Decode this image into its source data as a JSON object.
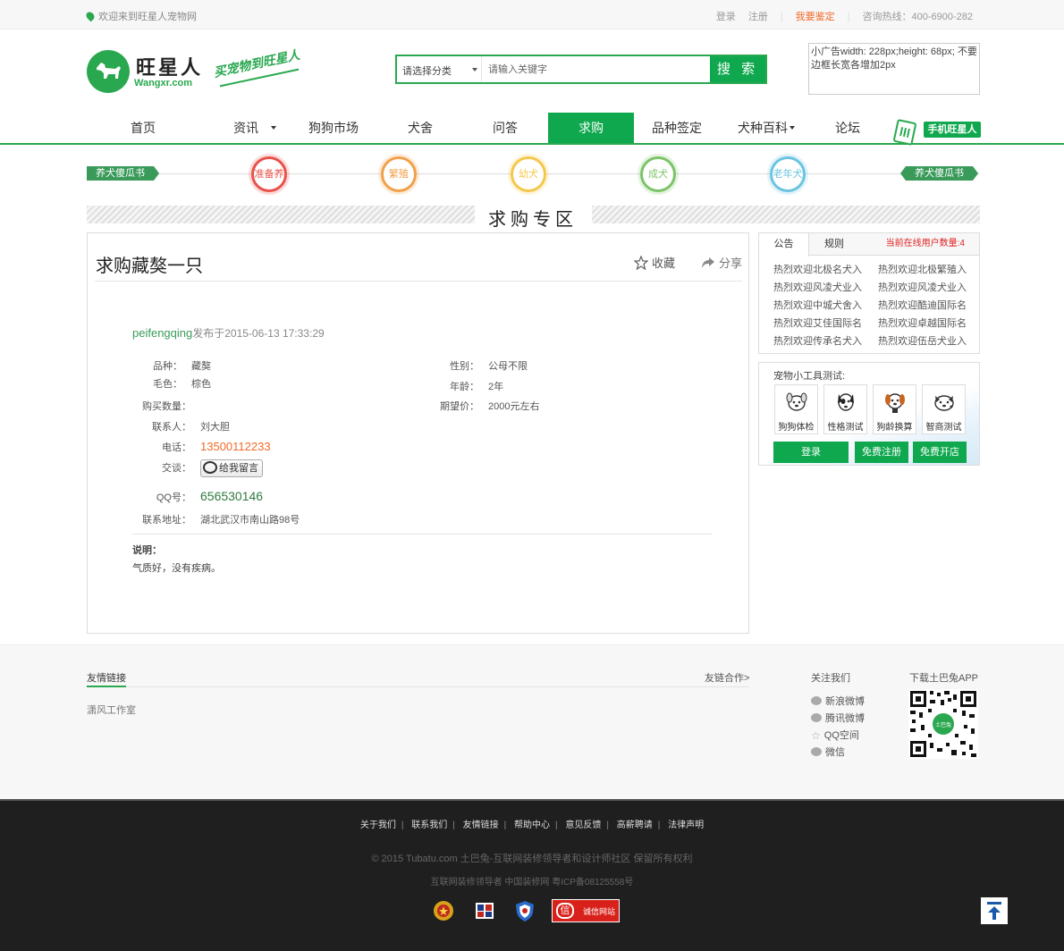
{
  "topbar": {
    "welcome": "欢迎来到旺星人宠物网",
    "login": "登录",
    "register": "注册",
    "appraise": "我要鉴定",
    "hotline": "咨询热线：400-6900-282"
  },
  "header": {
    "logo_text": "旺星人",
    "logo_sub": "Wangxr.com",
    "slogan": "买宠物到旺星人",
    "search": {
      "category": "请选择分类",
      "placeholder": "请输入关键字",
      "button": "搜 索"
    },
    "ad_text": "小广告width: 228px;height: 68px; 不要边框长宽各增加2px"
  },
  "nav": {
    "items": [
      "首页",
      "资讯",
      "狗狗市场",
      "犬舍",
      "问答",
      "求购",
      "品种签定",
      "犬种百科",
      "论坛"
    ],
    "active": "求购",
    "mobile": "手机旺星人"
  },
  "stages": {
    "left_tag": "养犬傻瓜书",
    "right_tag": "养犬傻瓜书",
    "items": [
      {
        "label": "准备养",
        "color": "#e8524a"
      },
      {
        "label": "繁殖",
        "color": "#f2a04a"
      },
      {
        "label": "幼犬",
        "color": "#f4c84a"
      },
      {
        "label": "成犬",
        "color": "#7cc46a"
      },
      {
        "label": "老年犬",
        "color": "#6ac4e0"
      }
    ]
  },
  "section_title": "求购专区",
  "post": {
    "title": "求购藏獒一只",
    "favorite": "收藏",
    "share": "分享",
    "user": "peifengqing",
    "published": "发布于2015-06-13 17:33:29",
    "fields": {
      "breed_k": "品种：",
      "breed_v": "藏獒",
      "color_k": "毛色：",
      "color_v": "棕色",
      "qty_k": "购买数量：",
      "contact_k": "联系人：",
      "contact_v": "刘大胆",
      "phone_k": "电话：",
      "phone_v": "13500112233",
      "chat_k": "交谈：",
      "chat_btn": "给我留言",
      "qq_k": "QQ号：",
      "qq_v": "656530146",
      "addr_k": "联系地址：",
      "addr_v": "湖北武汉市南山路98号",
      "sex_k": "性别：",
      "sex_v": "公母不限",
      "age_k": "年龄：",
      "age_v": "2年",
      "price_k": "期望价：",
      "price_v": "2000元左右"
    },
    "desc_k": "说明：",
    "desc_v": "气质好，没有疾病。"
  },
  "notice": {
    "tabs": [
      "公告",
      "规则"
    ],
    "online": "当前在线用户数量:4",
    "items": [
      "热烈欢迎北极名犬入",
      "热烈欢迎北极繁殖入",
      "热烈欢迎风凌犬业入",
      "热烈欢迎风凌犬业入",
      "热烈欢迎中城犬舍入",
      "热烈欢迎酷迪国际名",
      "热烈欢迎艾佳国际名",
      "热烈欢迎卓越国际名",
      "热烈欢迎传承名犬入",
      "热烈欢迎伍岳犬业入"
    ]
  },
  "tools": {
    "title": "宠物小工具测试:",
    "items": [
      "狗狗体检",
      "性格测试",
      "狗龄换算",
      "智商测试"
    ],
    "buttons": [
      "登录",
      "免费注册",
      "免费开店"
    ]
  },
  "footer": {
    "friend_links_title": "友情链接",
    "cooperate": "友链合作>",
    "friend_links": [
      "潇风工作室"
    ],
    "follow_title": "关注我们",
    "follow": [
      "新浪微博",
      "腾讯微博",
      "QQ空间",
      "微信"
    ],
    "app_title": "下载土巴兔APP",
    "qr_label": "土巴兔",
    "bottom_links": [
      "关于我们",
      "联系我们",
      "友情链接",
      "帮助中心",
      "意见反馈",
      "高薪聘请",
      "法律声明"
    ],
    "copyright": "© 2015 Tubatu.com 土巴兔-互联网装修领导者和设计师社区 保留所有权利",
    "icp": "互联网装修领导者 中国装修网 粤ICP备08125558号",
    "trust": "诚信网站"
  }
}
